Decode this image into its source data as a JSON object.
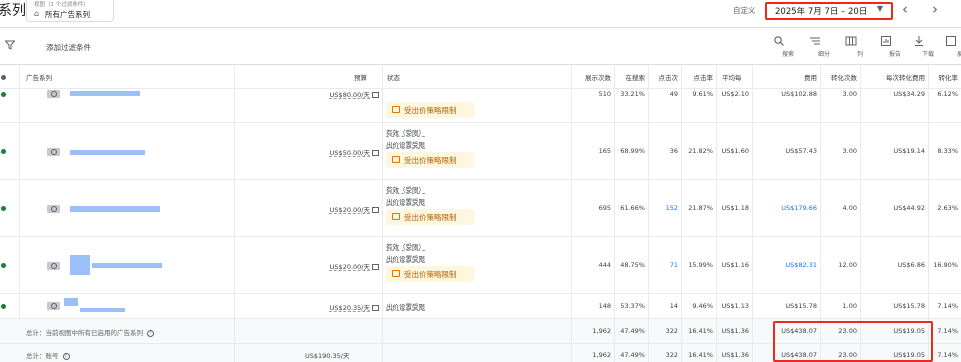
{
  "header": {
    "page_title": "系列",
    "view_caption": "视图（1 个过滤条件）",
    "view_name": "所有广告系列",
    "custom_label": "自定义",
    "date_range": "2025年 7月 7日 – 20日",
    "date_caret": "▼",
    "prev": "‹",
    "next": "›"
  },
  "toolbar": {
    "add_filter": "添加过滤条件",
    "tools": [
      {
        "label": "搜索",
        "icon": "search-icon"
      },
      {
        "label": "细分",
        "icon": "segment-icon"
      },
      {
        "label": "列",
        "icon": "columns-icon"
      },
      {
        "label": "报告",
        "icon": "report-icon"
      },
      {
        "label": "下载",
        "icon": "download-icon"
      },
      {
        "label": "展",
        "icon": "expand-icon"
      }
    ]
  },
  "columns": {
    "campaign": "广告系列",
    "budget": "预算",
    "status": "状态",
    "impressions": "展示次数",
    "search_share": "在搜索",
    "clicks": "点击次",
    "ctr": "点击率",
    "avg_cpc": "平均每",
    "cost": "费用",
    "conversions": "转化次数",
    "cost_per_conv": "每次转化费用",
    "conv_rate": "转化率"
  },
  "rows": [
    {
      "budget": "US$80.00/天",
      "status_lines": [],
      "warn": "受出价策略限制",
      "impressions": "510",
      "search_share": "33.21%",
      "clicks": "49",
      "ctr": "9.61%",
      "avg_cpc": "US$2.10",
      "cost": "US$102.88",
      "conversions": "3.00",
      "cost_per_conv": "US$34.29",
      "conv_rate": "6.12%"
    },
    {
      "budget": "US$50.00/天",
      "status_lines": [
        "有效（受限）",
        "出价设置受限"
      ],
      "warn": "受出价策略限制",
      "impressions": "165",
      "search_share": "68.99%",
      "clicks": "36",
      "ctr": "21.82%",
      "avg_cpc": "US$1.60",
      "cost": "US$57.43",
      "conversions": "3.00",
      "cost_per_conv": "US$19.14",
      "conv_rate": "8.33%"
    },
    {
      "budget": "US$20.00/天",
      "status_lines": [
        "有效（受限）",
        "出价设置受限"
      ],
      "warn": "受出价策略限制",
      "impressions": "695",
      "search_share": "61.66%",
      "clicks": "152",
      "ctr": "21.87%",
      "avg_cpc": "US$1.18",
      "cost": "US$179.66",
      "conversions": "4.00",
      "cost_per_conv": "US$44.92",
      "conv_rate": "2.63%"
    },
    {
      "budget": "US$20.00/天",
      "status_lines": [
        "有效（受限）",
        "出价设置受限"
      ],
      "warn": "受出价策略限制",
      "impressions": "444",
      "search_share": "48.75%",
      "clicks": "71",
      "ctr": "15.99%",
      "avg_cpc": "US$1.16",
      "cost": "US$82.31",
      "conversions": "12.00",
      "cost_per_conv": "US$6.86",
      "conv_rate": "16.90%"
    },
    {
      "budget": "US$20.35/天",
      "status_lines": [
        "出价设置受限"
      ],
      "warn": "",
      "impressions": "148",
      "search_share": "53.37%",
      "clicks": "14",
      "ctr": "9.46%",
      "avg_cpc": "US$1.13",
      "cost": "US$15.78",
      "conversions": "1.00",
      "cost_per_conv": "US$15.78",
      "conv_rate": "7.14%"
    }
  ],
  "totals": [
    {
      "label": "总计：当前视图中所有已启用的广告系列",
      "budget": "",
      "impressions": "1,962",
      "search_share": "47.49%",
      "clicks": "322",
      "ctr": "16.41%",
      "avg_cpc": "US$1.36",
      "cost": "US$438.07",
      "conversions": "23.00",
      "cost_per_conv": "US$19.05",
      "conv_rate": "7.14%"
    },
    {
      "label": "总计：账号",
      "budget": "US$190.35/天",
      "impressions": "1,962",
      "search_share": "47.49%",
      "clicks": "322",
      "ctr": "16.41%",
      "avg_cpc": "US$1.36",
      "cost": "US$438.07",
      "conversions": "23.00",
      "cost_per_conv": "US$19.05",
      "conv_rate": "7.14%"
    }
  ],
  "colors": {
    "accent": "#1a73e8",
    "highlight": "#ea2a1b",
    "status_green": "#188038",
    "warn_bg": "#fef7e0"
  }
}
